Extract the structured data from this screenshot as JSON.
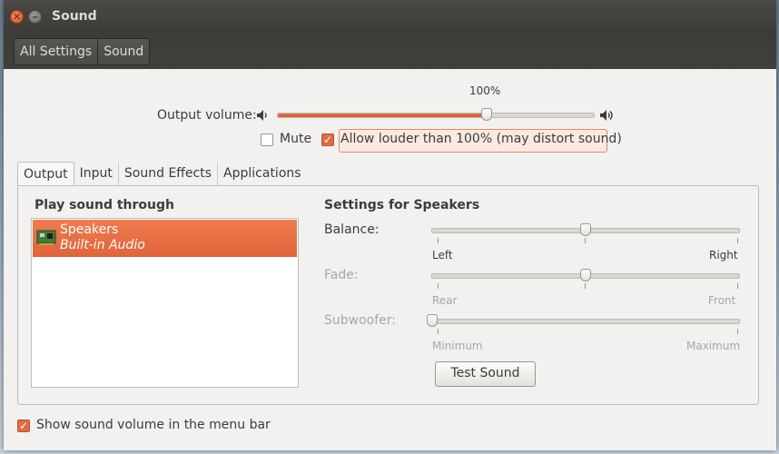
{
  "window": {
    "title": "Sound"
  },
  "breadcrumb": {
    "items": [
      "All Settings",
      "Sound"
    ]
  },
  "output_volume": {
    "label": "Output volume:",
    "percent_label": "100%",
    "level": 0.66
  },
  "mute": {
    "label": "Mute",
    "checked": false
  },
  "allow_louder": {
    "label": "Allow louder than 100% (may distort sound)",
    "checked": true
  },
  "tabs": [
    "Output",
    "Input",
    "Sound Effects",
    "Applications"
  ],
  "play_through": {
    "heading": "Play sound through",
    "devices": [
      {
        "name": "Speakers",
        "description": "Built-in Audio",
        "selected": true
      }
    ]
  },
  "settings": {
    "heading": "Settings for Speakers",
    "balance": {
      "label": "Balance:",
      "left": "Left",
      "right": "Right",
      "value": 0.5
    },
    "fade": {
      "label": "Fade:",
      "left": "Rear",
      "right": "Front",
      "value": 0.5
    },
    "subwoofer": {
      "label": "Subwoofer:",
      "left": "Minimum",
      "right": "Maximum",
      "value": 0.0
    },
    "test_button": "Test Sound"
  },
  "menu_bar_option": {
    "label": "Show sound volume in the menu bar",
    "checked": true
  },
  "colors": {
    "accent": "#e0643a",
    "titlebar": "#3c3b37"
  }
}
